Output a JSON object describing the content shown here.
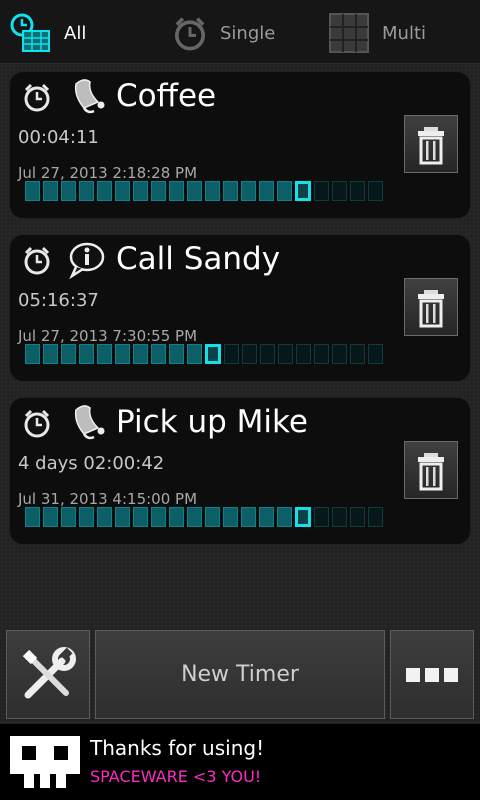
{
  "tabs": [
    {
      "label": "All",
      "icon": "alarm-multi-icon",
      "selected": true
    },
    {
      "label": "Single",
      "icon": "alarm-clock-icon",
      "selected": false
    },
    {
      "label": "Multi",
      "icon": "grid-icon",
      "selected": false
    }
  ],
  "timers": [
    {
      "title": "Coffee",
      "type_icon": "bell-icon",
      "remaining": "00:04:11",
      "due": "Jul 27, 2013 2:18:28 PM",
      "progress": {
        "segments": 20,
        "filled": 16
      }
    },
    {
      "title": "Call Sandy",
      "type_icon": "info-bubble-icon",
      "remaining": "05:16:37",
      "due": "Jul 27, 2013 7:30:55 PM",
      "progress": {
        "segments": 20,
        "filled": 11
      }
    },
    {
      "title": "Pick up Mike",
      "type_icon": "bell-icon",
      "remaining": "4 days 02:00:42",
      "due": "Jul 31, 2013 4:15:00 PM",
      "progress": {
        "segments": 20,
        "filled": 16
      }
    }
  ],
  "buttons": {
    "settings_icon": "wrench-screwdriver-icon",
    "new_timer": "New Timer",
    "more_icon": "more-dots-icon"
  },
  "banner": {
    "line1": "Thanks for using!",
    "line2": "SPACEWARE <3 YOU!",
    "line2_color": "#ff2bc2"
  },
  "colors": {
    "accent": "#12e0ea",
    "progress_done": "#0c5f66",
    "progress_empty": "#07181a"
  }
}
